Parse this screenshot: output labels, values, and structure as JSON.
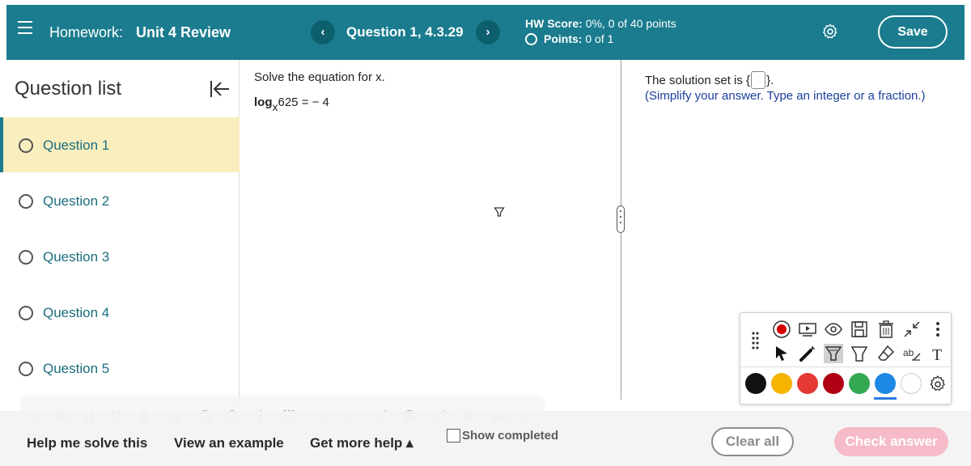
{
  "header": {
    "homework_prefix": "Homework:",
    "homework_title": "Unit 4 Review",
    "question_label": "Question 1, 4.3.29",
    "prev_icon": "chevron-left-icon",
    "next_icon": "chevron-right-icon",
    "hw_score_label": "HW Score:",
    "hw_score_value": "0%, 0 of 40 points",
    "points_label": "Points:",
    "points_value": "0 of 1",
    "save_label": "Save",
    "accent_color": "#1a7c8e"
  },
  "sidebar": {
    "title": "Question list",
    "items": [
      {
        "label": "Question 1",
        "active": true
      },
      {
        "label": "Question 2",
        "active": false
      },
      {
        "label": "Question 3",
        "active": false
      },
      {
        "label": "Question 4",
        "active": false
      },
      {
        "label": "Question 5",
        "active": false
      }
    ]
  },
  "question": {
    "prompt": "Solve the equation for x.",
    "eq_log": "log",
    "eq_base": "x",
    "eq_rest": "625 = − 4",
    "answer_prefix": "The solution set is {",
    "answer_suffix": "}.",
    "hint": "(Simplify your answer. Type an integer or a fraction.)"
  },
  "annotation_toolbar": {
    "tools_row1": [
      "record-icon",
      "present-icon",
      "eye-icon",
      "save-disk-icon",
      "trash-icon",
      "minimize-icon",
      "more-vertical-icon"
    ],
    "tools_row2": [
      "pointer-icon",
      "laser-pointer-icon",
      "highlighter-icon",
      "marker-icon",
      "eraser-icon",
      "text-strike-icon",
      "text-icon"
    ],
    "colors": [
      "#111111",
      "#f4b400",
      "#e53935",
      "#b00014",
      "#34a853",
      "#1e88e5",
      "#ffffff"
    ]
  },
  "bottom": {
    "help_me_solve": "Help me solve this",
    "view_example": "View an example",
    "get_more_help": "Get more help ▴",
    "show_completed": "Show completed",
    "clear_all": "Clear all",
    "check_answer": "Check answer"
  }
}
